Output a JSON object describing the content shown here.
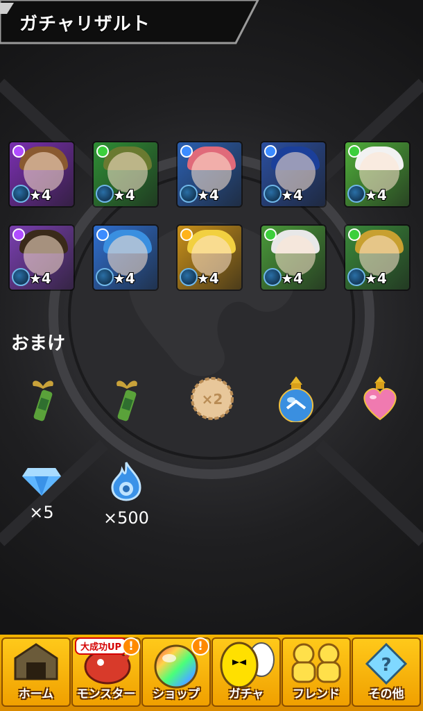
{
  "header": {
    "title": "ガチャリザルト"
  },
  "monsters": [
    {
      "rarity": "★4",
      "elem_color": "#b04dff",
      "bg": "#7a2fb0",
      "hair": "#8a5a30"
    },
    {
      "rarity": "★4",
      "elem_color": "#3ccf3c",
      "bg": "#2f8f35",
      "hair": "#6a7a30"
    },
    {
      "rarity": "★4",
      "elem_color": "#3c8cff",
      "bg": "#2b5fb0",
      "hair": "#e06a7a"
    },
    {
      "rarity": "★4",
      "elem_color": "#3c8cff",
      "bg": "#2b4fa0",
      "hair": "#1b3f9a"
    },
    {
      "rarity": "★4",
      "elem_color": "#3ccf3c",
      "bg": "#4fae3a",
      "hair": "#f2f2f2"
    },
    {
      "rarity": "★4",
      "elem_color": "#b04dff",
      "bg": "#7a3fb0",
      "hair": "#3a2a1a"
    },
    {
      "rarity": "★4",
      "elem_color": "#3c8cff",
      "bg": "#2f6fd0",
      "hair": "#3a8fe0"
    },
    {
      "rarity": "★4",
      "elem_color": "#ffb31a",
      "bg": "#c8901a",
      "hair": "#f2d040"
    },
    {
      "rarity": "★4",
      "elem_color": "#3ccf3c",
      "bg": "#4a9a3a",
      "hair": "#e8e8e8"
    },
    {
      "rarity": "★4",
      "elem_color": "#3ccf3c",
      "bg": "#3a8a3a",
      "hair": "#c8a030"
    }
  ],
  "bonus": {
    "title": "おまけ",
    "items": [
      "growth-potion-icon",
      "growth-potion-icon",
      "x2-cookie-icon",
      "blue-flask-icon",
      "heart-flask-icon"
    ],
    "x2_label": "×2",
    "resources": [
      {
        "icon": "gem-icon",
        "count": "×5"
      },
      {
        "icon": "soul-flame-icon",
        "count": "×500"
      }
    ]
  },
  "nav": {
    "items": [
      {
        "label": "ホーム",
        "icon": "home-icon"
      },
      {
        "label": "モンスター",
        "icon": "monster-icon"
      },
      {
        "label": "ショップ",
        "icon": "shop-orb-icon"
      },
      {
        "label": "ガチャ",
        "icon": "gacha-egg-icon"
      },
      {
        "label": "フレンド",
        "icon": "friends-icon"
      },
      {
        "label": "その他",
        "icon": "other-icon"
      }
    ],
    "monster_badge": "大成功UP",
    "alert_symbol": "!"
  },
  "colors": {
    "nav_bg": "#f0a000",
    "accent_orange": "#ff8a00"
  }
}
